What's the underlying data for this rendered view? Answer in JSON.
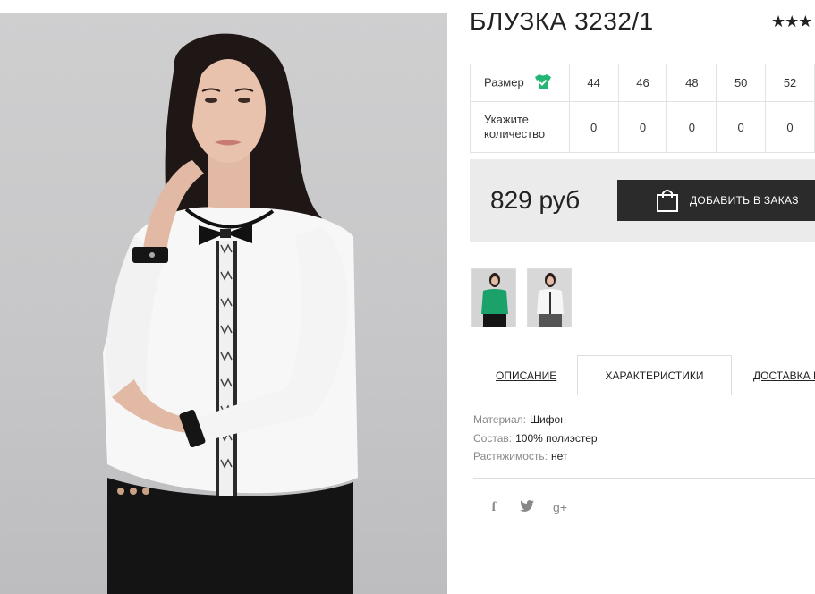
{
  "product": {
    "title": "БЛУЗКА 3232/1",
    "rating_stars": "★★★"
  },
  "sizes": {
    "size_label": "Размер",
    "qty_label": "Укажите количество",
    "size_icon": "shirt-check-icon",
    "items": [
      {
        "size": "44",
        "qty": "0"
      },
      {
        "size": "46",
        "qty": "0"
      },
      {
        "size": "48",
        "qty": "0"
      },
      {
        "size": "50",
        "qty": "0"
      },
      {
        "size": "52",
        "qty": "0"
      }
    ]
  },
  "purchase": {
    "price": "829 руб",
    "add_button": "ДОБАВИТЬ В ЗАКАЗ",
    "button_icon": "shopping-bag-icon"
  },
  "thumbnails": [
    {
      "alt": "green blouse",
      "color": "#1aa26a"
    },
    {
      "alt": "white blouse",
      "color": "#f2f2f2"
    }
  ],
  "tabs": {
    "description": "ОПИСАНИЕ",
    "characteristics": "ХАРАКТЕРИСТИКИ",
    "delivery": "ДОСТАВКА И"
  },
  "specs": [
    {
      "key": "Материал:",
      "value": "Шифон"
    },
    {
      "key": "Состав:",
      "value": "100% полиэстер"
    },
    {
      "key": "Растяжимость:",
      "value": "нет"
    }
  ],
  "social": {
    "facebook": "f",
    "twitter": "twitter-icon",
    "google_plus": "g+"
  },
  "colors": {
    "accent": "#22b573",
    "button_bg": "#2b2b2b",
    "price_bg": "#ebebeb"
  }
}
